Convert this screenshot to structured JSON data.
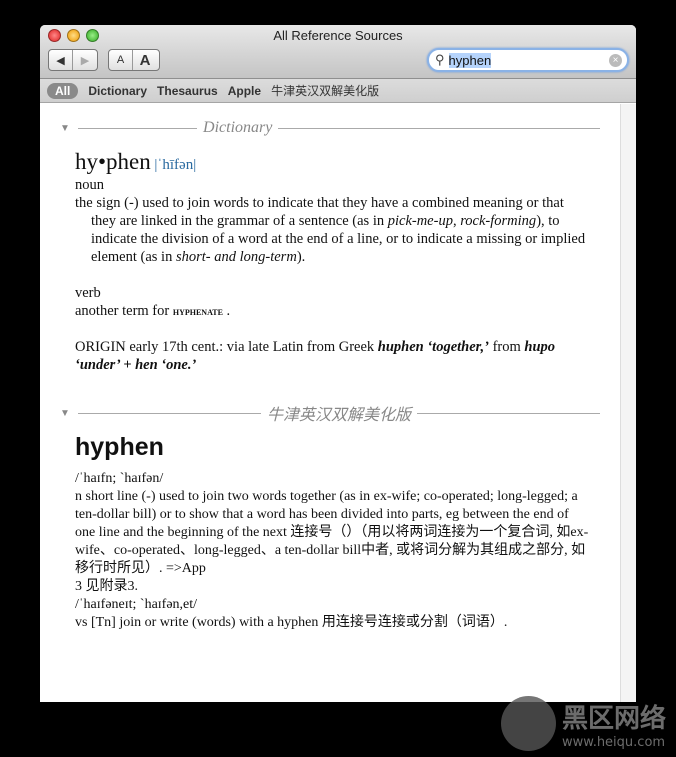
{
  "window": {
    "title": "All Reference Sources"
  },
  "toolbar": {
    "back": "◀",
    "forward": "▶",
    "font_smaller": "A",
    "font_larger": "A"
  },
  "search": {
    "value": "hyphen",
    "clear": "×"
  },
  "scopes": [
    "All",
    "Dictionary",
    "Thesaurus",
    "Apple",
    "牛津英汉双解美化版"
  ],
  "dictionary": {
    "section": "Dictionary",
    "headword": "hy•phen",
    "pron": "|ˈhīfən|",
    "pos1": "noun",
    "def1_a": "the sign (-) used to join words to indicate that they have a combined meaning or that they are linked in the grammar of a sentence (as in ",
    "def1_i1": "pick-me-up",
    "def1_b": ", ",
    "def1_i2": "rock-forming",
    "def1_c": "), to indicate the division of a word at the end of a line, or to indicate a missing or implied element (as in ",
    "def1_i3": "short- and long-term",
    "def1_d": ").",
    "pos2": "verb",
    "def2": "another term for ",
    "def2_ref": "hyphenate",
    "def2_end": " .",
    "origin_a": "ORIGIN early 17th cent.: via late Latin from Greek ",
    "origin_b": "huphen ‘together,’",
    "origin_c": " from ",
    "origin_d": "hupo ‘under’ + hen ‘one.’"
  },
  "oxford": {
    "section": "牛津英汉双解美化版",
    "headword": "hyphen",
    "lines": [
      "/ˈhaɪfn; `haɪfən/",
      "n short line (-) used to join two words together (as in ex-wife; co-operated; long-legged; a ten-dollar bill) or to show that a word has been divided into parts, eg between the end of one line and the beginning of the next 连接号（）（用以将两词连接为一个复合词, 如ex-wife、co-operated、long-legged、a ten-dollar bill中者, 或将词分解为其组成之部分, 如移行时所见）. =>App",
      "3 见附录3.",
      "/ˈhaɪfəneɪt; `haɪfən,et/",
      "vs [Tn] join or write (words) with a hyphen 用连接号连接或分割（词语）."
    ]
  },
  "watermark": {
    "name": "黑区网络",
    "url": "www.heiqu.com"
  }
}
